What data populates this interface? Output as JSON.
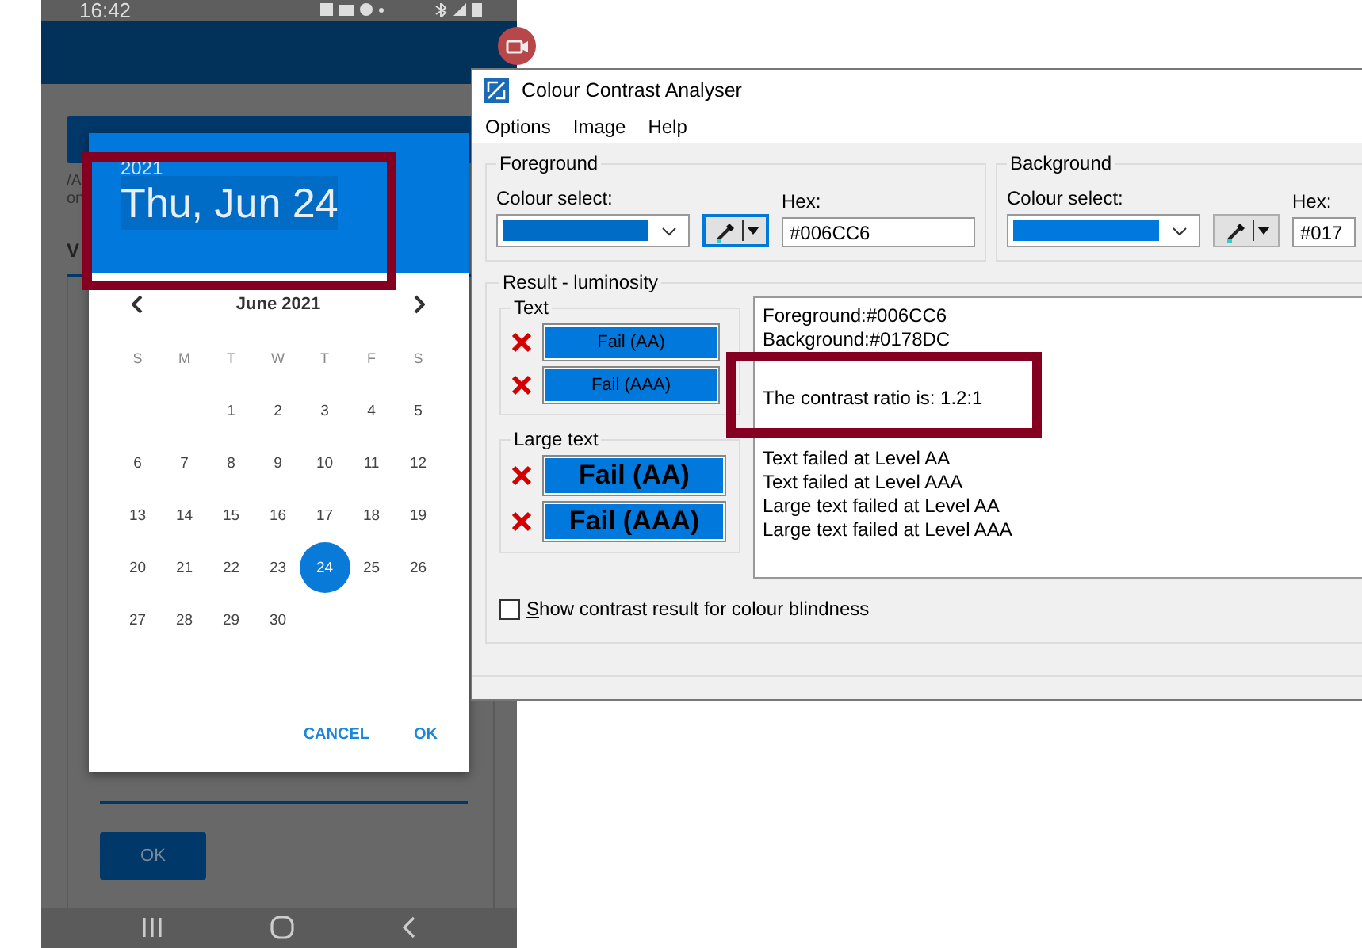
{
  "phone": {
    "status_time": "16:42",
    "behind_texts": [
      "/A",
      "on"
    ],
    "tab_letter": "V",
    "ok_button": "OK"
  },
  "date_picker": {
    "year": "2021",
    "date": "Thu, Jun 24",
    "month": "June 2021",
    "weekdays": [
      "S",
      "M",
      "T",
      "W",
      "T",
      "F",
      "S"
    ],
    "weeks": [
      [
        {
          "kind": "blank"
        },
        {
          "kind": "blank"
        },
        {
          "label": "1",
          "selected": false
        },
        {
          "label": "2",
          "selected": false
        },
        {
          "label": "3",
          "selected": false
        },
        {
          "label": "4",
          "selected": false
        },
        {
          "label": "5",
          "selected": false
        }
      ],
      [
        {
          "label": "6",
          "selected": false
        },
        {
          "label": "7",
          "selected": false
        },
        {
          "label": "8",
          "selected": false
        },
        {
          "label": "9",
          "selected": false
        },
        {
          "label": "10",
          "selected": false
        },
        {
          "label": "11",
          "selected": false
        },
        {
          "label": "12",
          "selected": false
        }
      ],
      [
        {
          "label": "13",
          "selected": false
        },
        {
          "label": "14",
          "selected": false
        },
        {
          "label": "15",
          "selected": false
        },
        {
          "label": "16",
          "selected": false
        },
        {
          "label": "17",
          "selected": false
        },
        {
          "label": "18",
          "selected": false
        },
        {
          "label": "19",
          "selected": false
        }
      ],
      [
        {
          "label": "20",
          "selected": false
        },
        {
          "label": "21",
          "selected": false
        },
        {
          "label": "22",
          "selected": false
        },
        {
          "label": "23",
          "selected": false
        },
        {
          "label": "24",
          "selected": true
        },
        {
          "label": "25",
          "selected": false
        },
        {
          "label": "26",
          "selected": false
        }
      ],
      [
        {
          "label": "27",
          "selected": false
        },
        {
          "label": "28",
          "selected": false
        },
        {
          "label": "29",
          "selected": false
        },
        {
          "label": "30",
          "selected": false
        }
      ]
    ],
    "actions": [
      "CANCEL",
      "OK"
    ]
  },
  "analyser": {
    "title": "Colour Contrast Analyser",
    "menu": [
      "Options",
      "Image",
      "Help"
    ],
    "panels": [
      {
        "legend": "Foreground",
        "select_label": "Colour select:",
        "color": "#006cc6",
        "hex_label": "Hex:",
        "hex": "#006CC6",
        "picker_focused": true
      },
      {
        "legend": "Background",
        "select_label": "Colour select:",
        "color": "#0178dc",
        "hex_label": "Hex:",
        "hex": "#017",
        "picker_focused": false
      }
    ],
    "result": {
      "legend": "Result - luminosity",
      "groups": [
        {
          "legend": "Text",
          "kind": "normal",
          "results": [
            {
              "label": "Fail (AA)",
              "passed": false
            },
            {
              "label": "Fail (AAA)",
              "passed": false
            }
          ]
        },
        {
          "legend": "Large text",
          "kind": "large",
          "results": [
            {
              "label": "Fail (AA)",
              "passed": false
            },
            {
              "label": "Fail (AAA)",
              "passed": false
            }
          ]
        }
      ],
      "report_header": [
        "Foreground:#006CC6",
        "Background:#0178DC"
      ],
      "ratio": "The contrast ratio is: 1.2:1",
      "report_details": [
        "Text failed at Level AA",
        "Text failed at Level AAA",
        "Large text failed at Level AA",
        "Large text failed at Level AAA"
      ]
    },
    "checkbox": {
      "label": "Show contrast result for colour blindness",
      "checked": false
    }
  }
}
